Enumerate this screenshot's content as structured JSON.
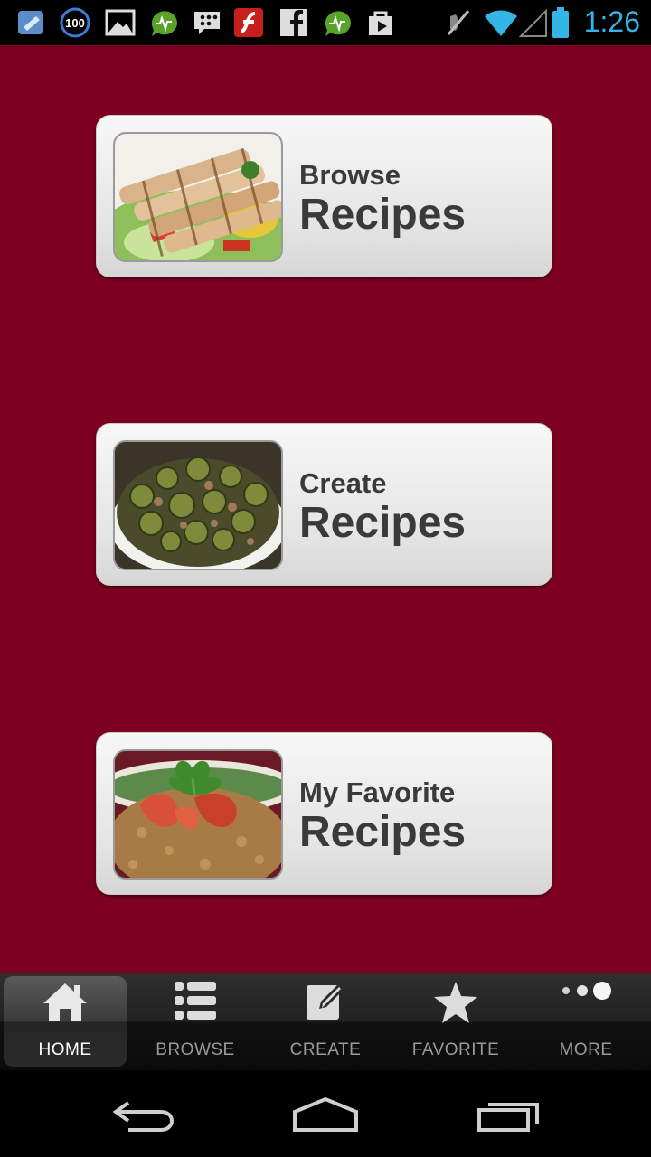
{
  "status_bar": {
    "time": "1:26",
    "battery_badge": "100",
    "notification_icons": [
      "pushbullet-icon",
      "battery-100-icon",
      "gallery-icon",
      "activity-icon",
      "bbm-icon",
      "flash-icon",
      "facebook-icon",
      "activity-icon",
      "play-store-icon"
    ],
    "system_icons": [
      "mute-icon",
      "wifi-icon",
      "signal-icon",
      "battery-icon"
    ],
    "accent": "#33b5e5"
  },
  "cards": [
    {
      "line1": "Browse",
      "line2": "Recipes",
      "image": "grilled-chicken-salad"
    },
    {
      "line1": "Create",
      "line2": "Recipes",
      "image": "brussels-sprouts"
    },
    {
      "line1": "My Favorite",
      "line2": "Recipes",
      "image": "crab-cake-salsa"
    }
  ],
  "tabs": [
    {
      "label": "HOME",
      "icon": "home-icon",
      "active": true
    },
    {
      "label": "BROWSE",
      "icon": "list-icon",
      "active": false
    },
    {
      "label": "CREATE",
      "icon": "edit-icon",
      "active": false
    },
    {
      "label": "FAVORITE",
      "icon": "star-icon",
      "active": false
    },
    {
      "label": "MORE",
      "icon": "more-icon",
      "active": false
    }
  ],
  "nav": [
    "back-icon",
    "home-nav-icon",
    "recents-icon"
  ],
  "colors": {
    "background": "#7d0020",
    "card_text": "#3a3a3a"
  }
}
